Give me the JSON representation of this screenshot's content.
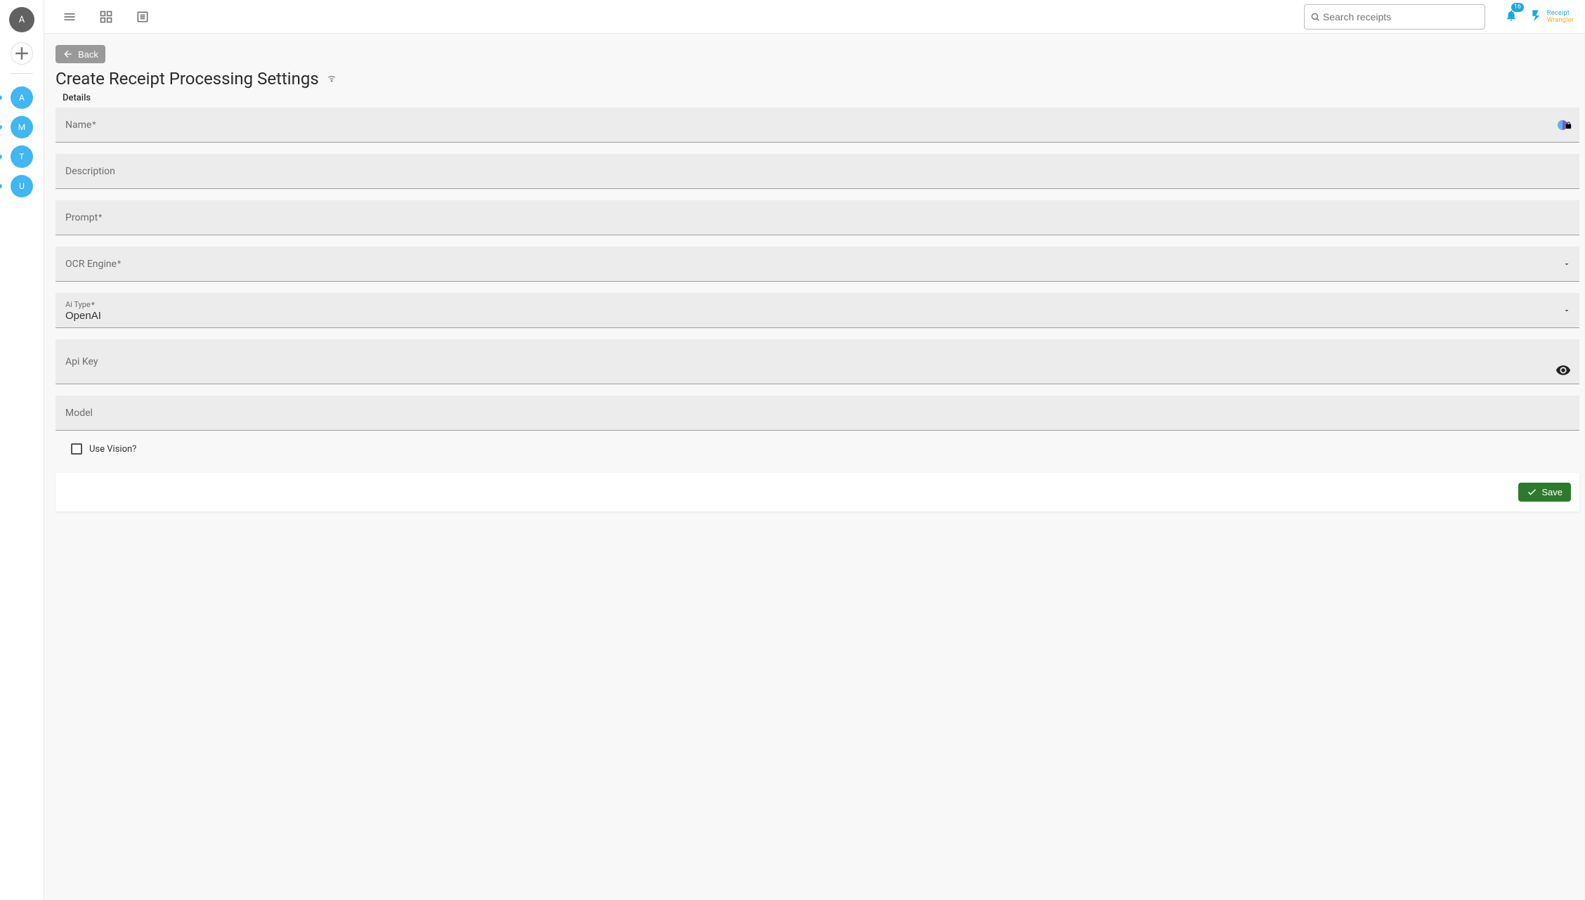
{
  "sidebar": {
    "main_avatar": "A",
    "workspaces": [
      {
        "letter": "A"
      },
      {
        "letter": "M"
      },
      {
        "letter": "T"
      },
      {
        "letter": "U"
      }
    ]
  },
  "topbar": {
    "search_placeholder": "Search receipts",
    "notif_count": "16",
    "logo_top": "Receipt",
    "logo_bottom": "Wrangler"
  },
  "page": {
    "back_label": "Back",
    "title": "Create Receipt Processing Settings",
    "section_details": "Details",
    "fields": {
      "name_label": "Name",
      "name_value": "",
      "description_label": "Description",
      "description_value": "",
      "prompt_label": "Prompt",
      "prompt_value": "",
      "ocr_engine_label": "OCR Engine",
      "ocr_engine_value": "",
      "ai_type_label": "Ai Type",
      "ai_type_value": "OpenAI",
      "api_key_label": "Api Key",
      "api_key_value": "",
      "model_label": "Model",
      "model_value": "",
      "use_vision_label": "Use Vision?"
    },
    "save_label": "Save"
  }
}
